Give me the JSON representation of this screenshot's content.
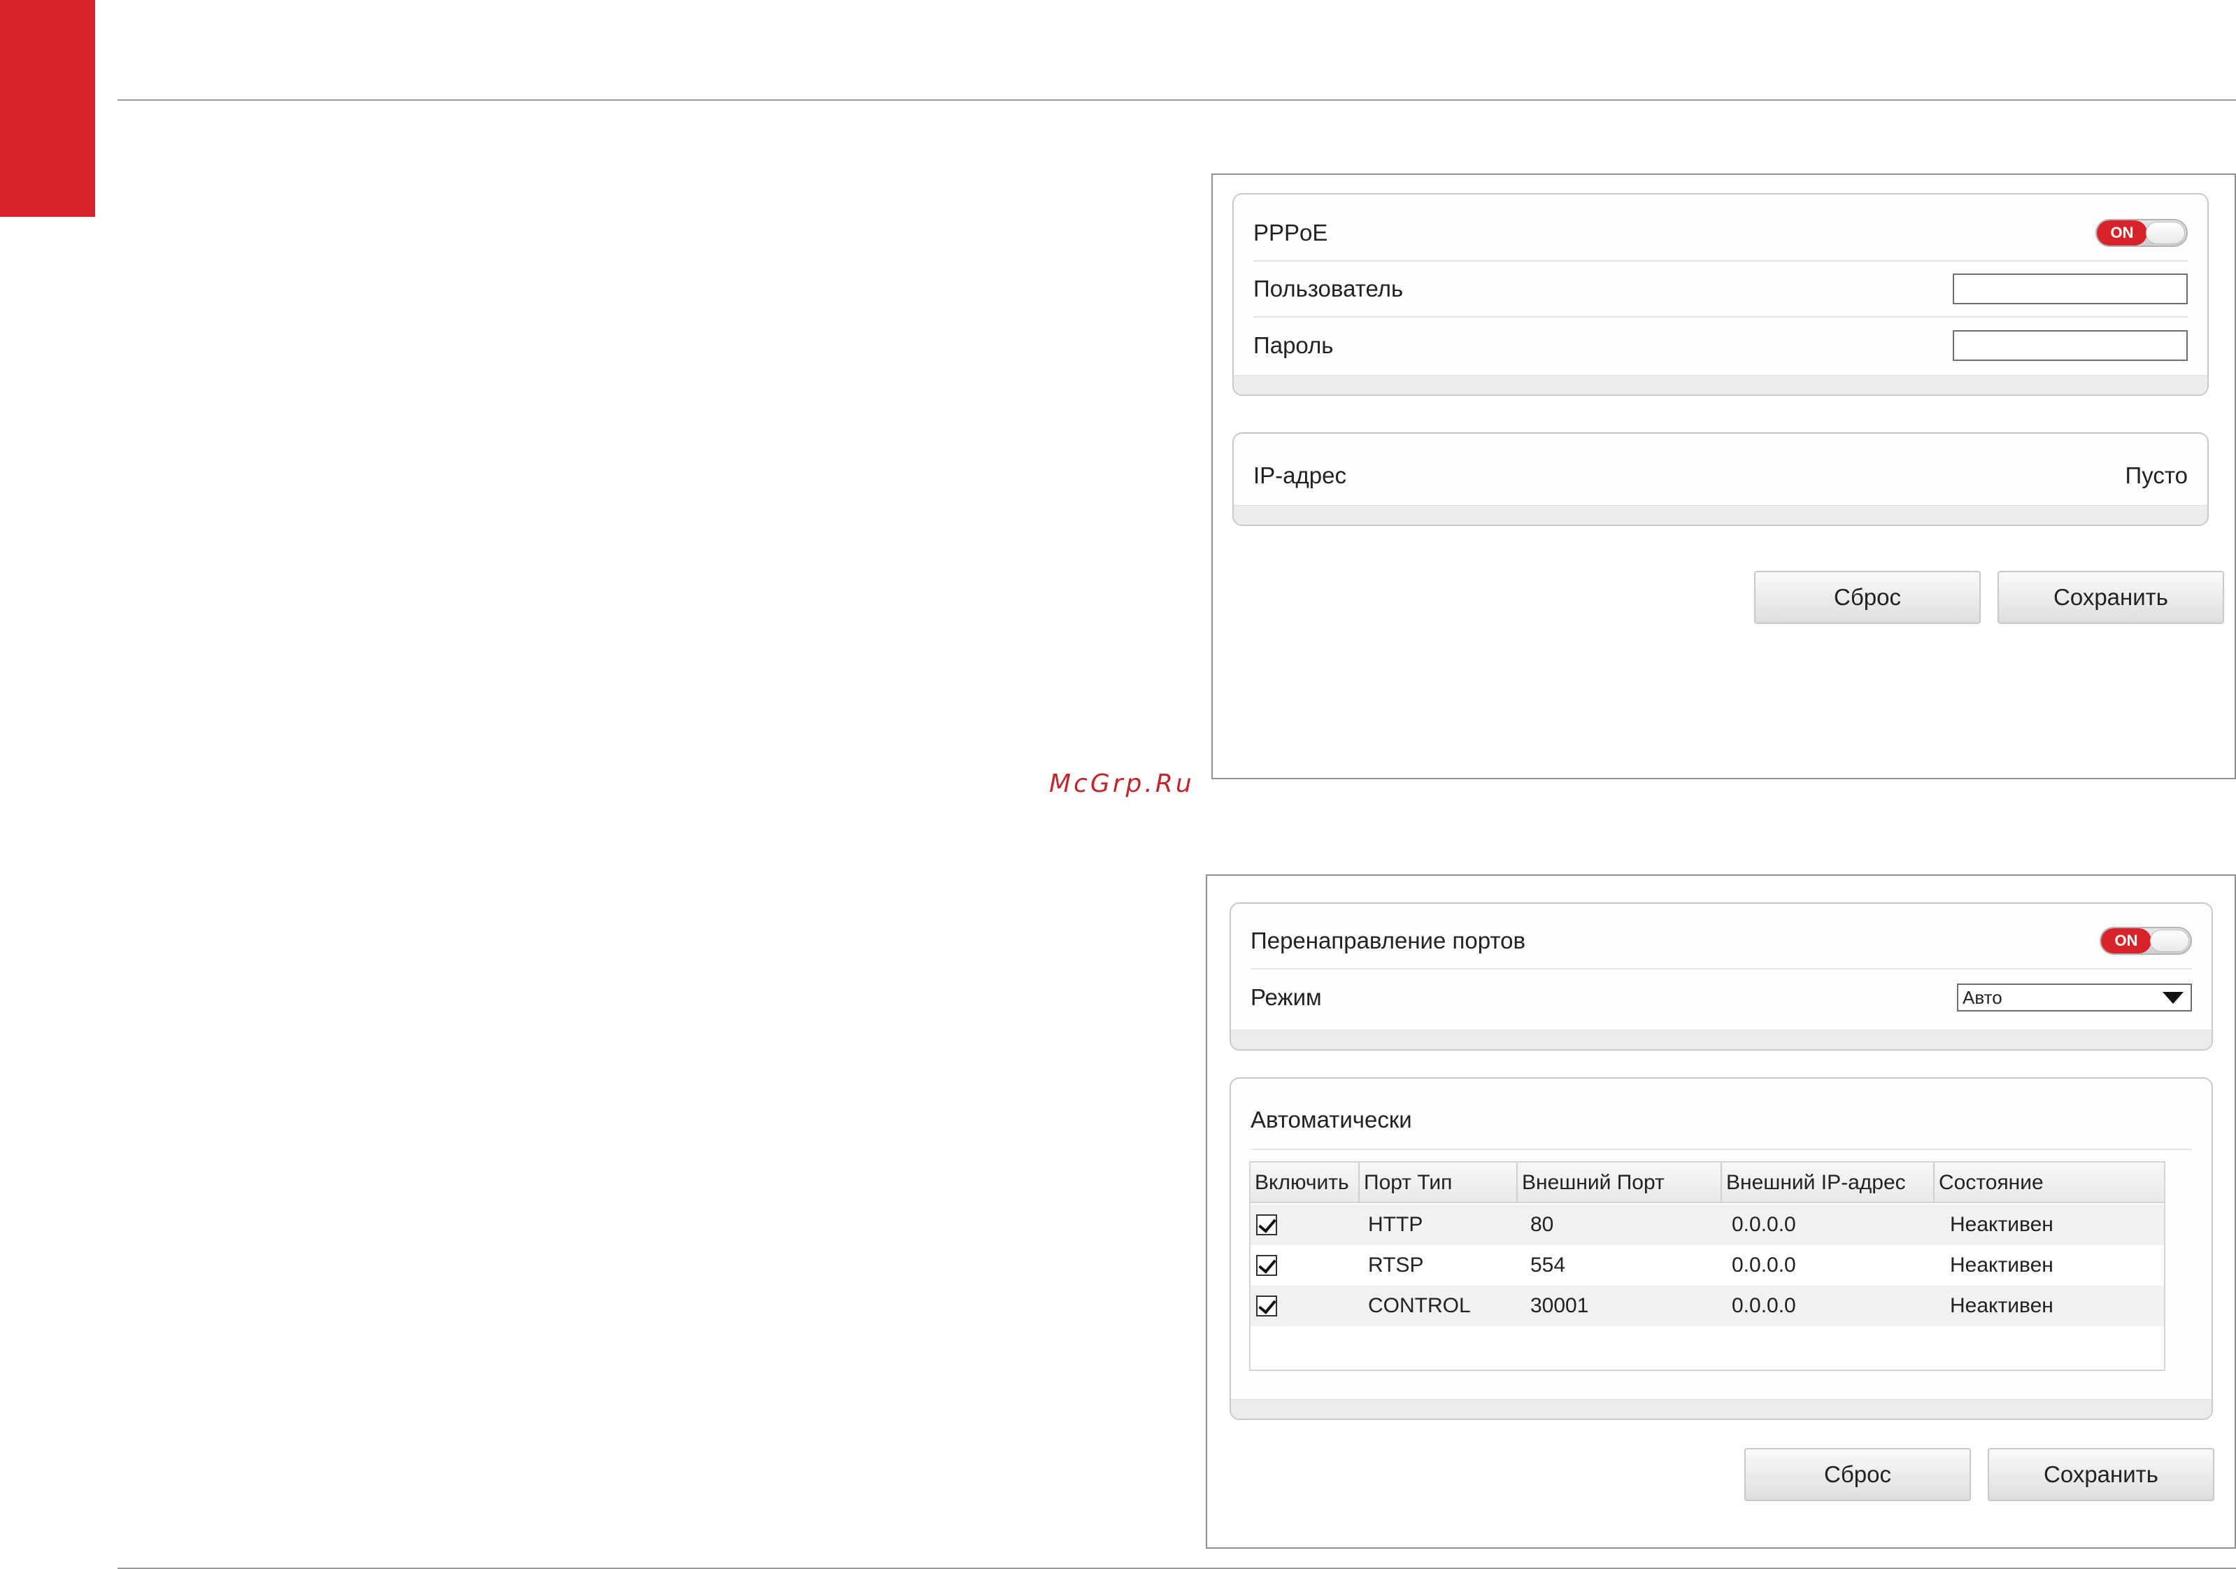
{
  "watermark": "McGrp.Ru",
  "pppoe_panel": {
    "pppoe_label": "PPPoE",
    "pppoe_toggle": "ON",
    "user_label": "Пользователь",
    "user_value": "",
    "password_label": "Пароль",
    "password_value": "",
    "ip_label": "IP-адрес",
    "ip_value": "Пусто",
    "reset_button": "Сброс",
    "save_button": "Сохранить"
  },
  "port_forwarding_panel": {
    "forwarding_label": "Перенаправление портов",
    "forwarding_toggle": "ON",
    "mode_label": "Режим",
    "mode_selected": "Авто",
    "auto_section_title": "Автоматически",
    "table": {
      "headers": [
        "Включить",
        "Порт Тип",
        "Внешний  Порт",
        "Внешний  IP-адрес",
        "Состояние"
      ],
      "rows": [
        {
          "enabled": true,
          "type": "HTTP",
          "port": "80",
          "ip": "0.0.0.0",
          "status": "Неактивен"
        },
        {
          "enabled": true,
          "type": "RTSP",
          "port": "554",
          "ip": "0.0.0.0",
          "status": "Неактивен"
        },
        {
          "enabled": true,
          "type": "CONTROL",
          "port": "30001",
          "ip": "0.0.0.0",
          "status": "Неактивен"
        }
      ]
    },
    "reset_button": "Сброс",
    "save_button": "Сохранить"
  },
  "colors": {
    "accent_red": "#d8232a",
    "border_gray": "#8f8f8f"
  }
}
